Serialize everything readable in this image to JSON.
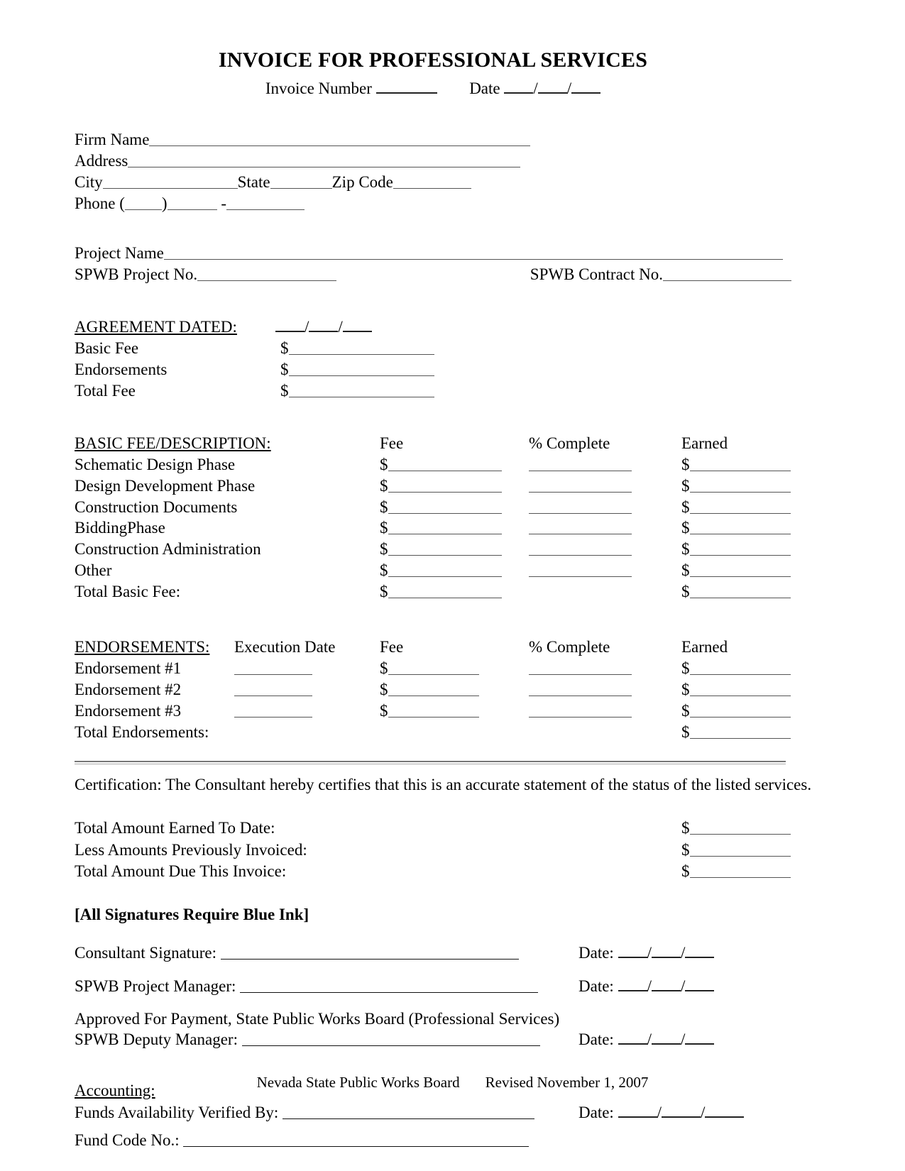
{
  "document": {
    "title": "INVOICE FOR PROFESSIONAL SERVICES",
    "invoice_number_label": "Invoice Number",
    "date_label": "Date"
  },
  "firm": {
    "firm_name_label": "Firm Name",
    "address_label": "Address",
    "city_label": "City",
    "state_label": "State",
    "zip_label": "Zip Code",
    "phone_label": "Phone (",
    "phone_paren_close": ")",
    "phone_dash": "-"
  },
  "project": {
    "project_name_label": "Project Name",
    "spwb_project_no_label": "SPWB Project No.",
    "spwb_contract_no_label": "SPWB Contract No."
  },
  "agreement": {
    "heading": "AGREEMENT DATED:",
    "rows": [
      {
        "label": "Basic Fee"
      },
      {
        "label": "Endorsements"
      },
      {
        "label": "Total Fee"
      }
    ]
  },
  "basic_fee": {
    "heading": "BASIC FEE/DESCRIPTION:",
    "columns": {
      "fee": "Fee",
      "percent_complete": "% Complete",
      "earned": "Earned"
    },
    "rows": [
      {
        "label": "Schematic Design Phase",
        "has_percent": true
      },
      {
        "label": "Design Development Phase",
        "has_percent": true
      },
      {
        "label": "Construction Documents",
        "has_percent": true
      },
      {
        "label": "BiddingPhase",
        "has_percent": true
      },
      {
        "label": "Construction Administration",
        "has_percent": true
      },
      {
        "label": "Other",
        "has_percent": true
      }
    ],
    "total_row": {
      "label": "Total Basic Fee:",
      "has_percent": false
    }
  },
  "endorsements": {
    "heading": "ENDORSEMENTS:",
    "columns": {
      "execution_date": "Execution Date",
      "fee": "Fee",
      "percent_complete": "% Complete",
      "earned": "Earned"
    },
    "rows": [
      {
        "label": "Endorsement #1"
      },
      {
        "label": "Endorsement #2"
      },
      {
        "label": "Endorsement #3"
      }
    ],
    "total_row": {
      "label": "Total Endorsements:"
    }
  },
  "certification": {
    "text": "Certification:  The Consultant hereby certifies that this is an accurate statement of the status of the listed services."
  },
  "totals": {
    "rows": [
      {
        "label": "Total Amount Earned To Date:"
      },
      {
        "label": "Less Amounts Previously Invoiced:"
      },
      {
        "label": "Total Amount Due This Invoice:"
      }
    ]
  },
  "signatures": {
    "blue_ink_notice": "[All Signatures Require Blue Ink]",
    "date_label": "Date:",
    "consultant_label": "Consultant Signature:",
    "project_manager_label": "SPWB Project Manager:",
    "approval_text": "Approved For Payment, State Public Works Board  (Professional Services)",
    "deputy_manager_label": "SPWB Deputy Manager:"
  },
  "accounting": {
    "heading": "Accounting:",
    "funds_verified_label": "Funds Availability Verified By:",
    "fund_code_label": "Fund Code No.:",
    "date_label": "Date:"
  },
  "footer": {
    "agency": "Nevada State Public Works Board",
    "revision": "Revised November 1, 2007"
  }
}
